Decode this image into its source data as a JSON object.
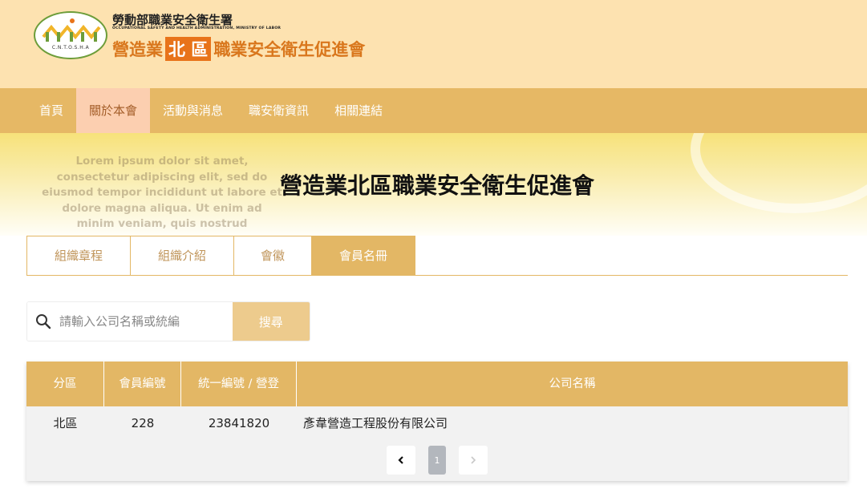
{
  "header": {
    "logo_abbr": "C.N.T.O.S.H.A",
    "org_name_cn": "勞動部職業安全衛生署",
    "org_name_en": "OCCUPATIONAL SAFETY AND HEALTH ADMINISTRATION, MINISTRY OF LABOR",
    "assoc_title_part1": "營造業",
    "assoc_title_highlight": "北 區",
    "assoc_title_part2": "職業安全衛生促進會",
    "accent_color": "#e8731a"
  },
  "nav": {
    "items": [
      {
        "label": "首頁"
      },
      {
        "label": "關於本會"
      },
      {
        "label": "活動與消息"
      },
      {
        "label": "職安衛資訊"
      },
      {
        "label": "相關連結"
      }
    ],
    "active": "關於本會"
  },
  "banner": {
    "background_text": "Lorem ipsum dolor sit amet, consectetur adipiscing elit, sed do eiusmod tempor incididunt ut labore et dolore magna aliqua. Ut enim ad minim veniam, quis nostrud exercitation ullamco laboris nisi",
    "title": "營造業北區職業安全衛生促進會"
  },
  "tabs": {
    "items": [
      {
        "label": "組織章程"
      },
      {
        "label": "組織介紹"
      },
      {
        "label": "會徽"
      },
      {
        "label": "會員名冊"
      }
    ],
    "active": "會員名冊"
  },
  "search": {
    "placeholder": "請輸入公司名稱或統編",
    "button_label": "搜尋"
  },
  "table": {
    "columns": [
      "分區",
      "會員編號",
      "統一編號 / 營登",
      "公司名稱"
    ],
    "rows": [
      [
        "北區",
        "228",
        "23841820",
        "彥韋營造工程股份有限公司"
      ]
    ]
  },
  "pagination": {
    "current_page": "1",
    "prev_icon": "chevron-left-icon",
    "next_icon": "chevron-right-icon"
  }
}
